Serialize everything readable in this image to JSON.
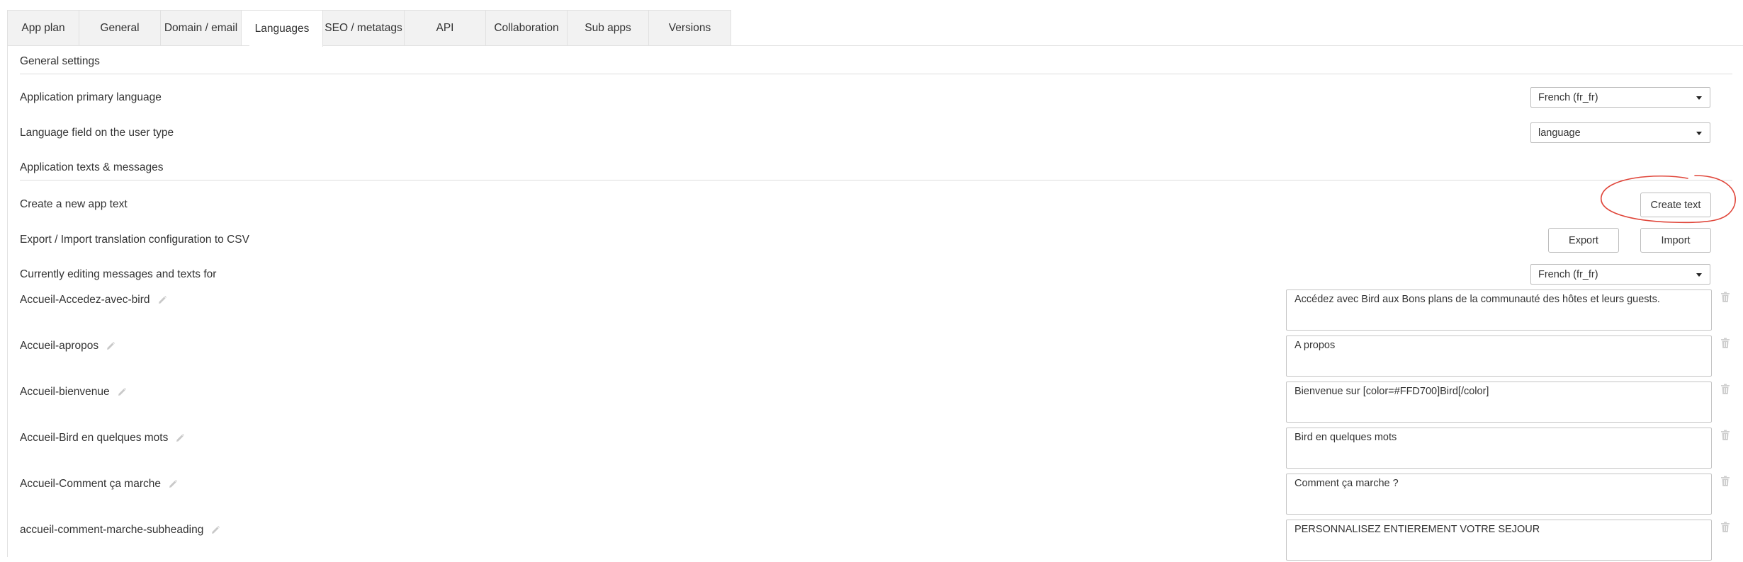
{
  "tabs": [
    {
      "label": "App plan"
    },
    {
      "label": "General"
    },
    {
      "label": "Domain / email"
    },
    {
      "label": "Languages"
    },
    {
      "label": "SEO / metatags"
    },
    {
      "label": "API"
    },
    {
      "label": "Collaboration"
    },
    {
      "label": "Sub apps"
    },
    {
      "label": "Versions"
    }
  ],
  "active_tab": "Languages",
  "general_settings": {
    "title": "General settings",
    "primary_language_label": "Application primary language",
    "primary_language_value": "French (fr_fr)",
    "language_field_label": "Language field on the user type",
    "language_field_value": "language"
  },
  "texts_section": {
    "title": "Application texts & messages",
    "create_label": "Create a new app text",
    "create_button": "Create text",
    "export_import_label": "Export / Import translation configuration to CSV",
    "export_button": "Export",
    "import_button": "Import",
    "editing_label": "Currently editing messages and texts for",
    "editing_value": "French (fr_fr)"
  },
  "app_texts": [
    {
      "key": "Accueil-Accedez-avec-bird",
      "value": "Accédez avec Bird aux Bons plans de la communauté des hôtes et leurs guests."
    },
    {
      "key": "Accueil-apropos",
      "value": "A propos"
    },
    {
      "key": "Accueil-bienvenue",
      "value": "Bienvenue sur [color=#FFD700]Bird[/color]"
    },
    {
      "key": "Accueil-Bird en quelques mots",
      "value": "Bird en quelques mots"
    },
    {
      "key": "Accueil-Comment ça marche",
      "value": "Comment ça marche ?"
    },
    {
      "key": "accueil-comment-marche-subheading",
      "value": "PERSONNALISEZ ENTIEREMENT VOTRE SEJOUR"
    }
  ],
  "icons": {
    "edit": "pencil-icon",
    "delete": "trash-icon",
    "dropdown": "caret-down-icon"
  },
  "colors": {
    "annotation": "#e0463a",
    "tab_bar": "#f2f2f2",
    "border": "#e1e1e1"
  }
}
